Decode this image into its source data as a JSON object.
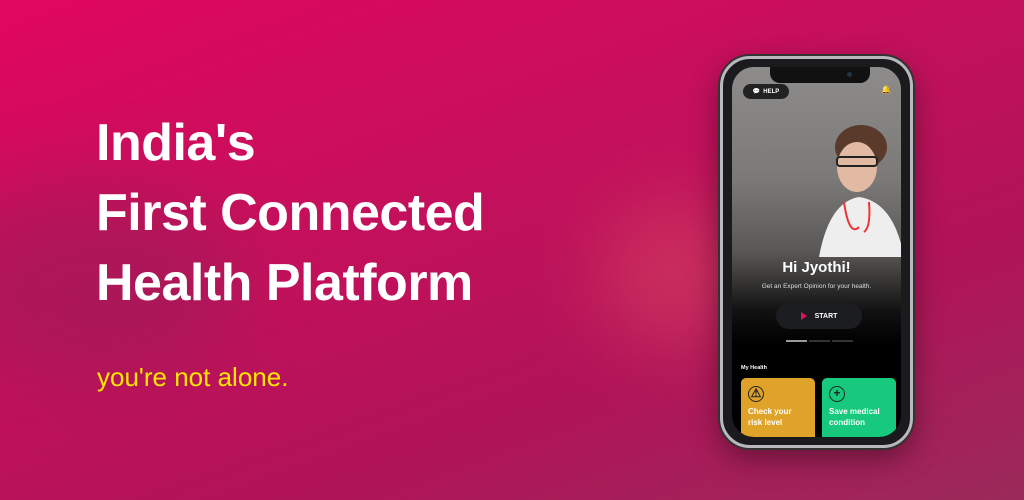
{
  "headline": {
    "line1": "India's",
    "line2": "First Connected",
    "line3": "Health Platform"
  },
  "tagline": "you're not alone.",
  "phone": {
    "help_label": "HELP",
    "greeting": "Hi Jyothi!",
    "subtitle": "Get an Expert Opinion for your health.",
    "start_label": "START",
    "section_title": "My Health",
    "cards": [
      {
        "label": "Check your risk level",
        "color": "#e0a32a"
      },
      {
        "label": "Save medical condition",
        "color": "#16c97c"
      }
    ]
  },
  "colors": {
    "background": "#c5105c",
    "tagline": "#ffe600"
  }
}
